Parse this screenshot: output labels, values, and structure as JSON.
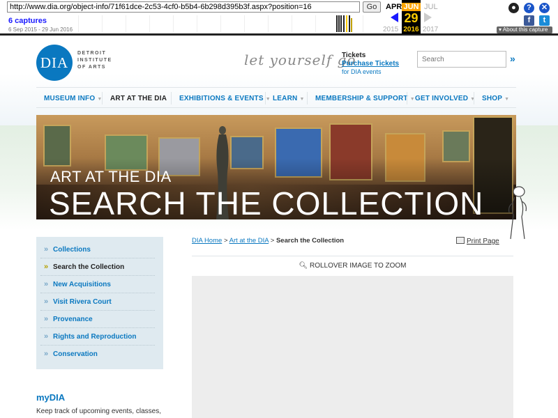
{
  "wayback": {
    "url": "http://www.dia.org/object-info/71f61dce-2c53-4cf0-b5b4-6b298d395b3f.aspx?position=16",
    "go_label": "Go",
    "captures": "6 captures",
    "range": "6 Sep 2015 - 29 Jun 2016",
    "month_prev": "APR",
    "month_cur": "JUN",
    "month_next": "JUL",
    "day": "29",
    "year_prev": "2015",
    "year_cur": "2016",
    "year_next": "2017",
    "about": "▾ About this capture"
  },
  "header": {
    "logo_letters": "DIA",
    "logo_lines": [
      "DETROIT",
      "INSTITUTE",
      "OF ARTS"
    ],
    "tagline": "let yourself go",
    "tickets_title": "Tickets",
    "tickets_link": "Purchase Tickets",
    "tickets_sub": "for DIA events",
    "search_placeholder": "Search",
    "search_go": "»"
  },
  "nav": [
    {
      "label": "MUSEUM INFO",
      "active": false
    },
    {
      "label": "ART AT THE DIA",
      "active": true
    },
    {
      "label": "EXHIBITIONS & EVENTS",
      "active": false
    },
    {
      "label": "LEARN",
      "active": false
    },
    {
      "label": "MEMBERSHIP & SUPPORT",
      "active": false
    },
    {
      "label": "GET INVOLVED",
      "active": false
    },
    {
      "label": "SHOP",
      "active": false
    }
  ],
  "banner": {
    "subtitle": "ART AT THE DIA",
    "title": "SEARCH THE COLLECTION"
  },
  "sidebar": {
    "items": [
      {
        "label": "Collections"
      },
      {
        "label": "Search the Collection"
      },
      {
        "label": "New Acquisitions"
      },
      {
        "label": "Visit Rivera Court"
      },
      {
        "label": "Provenance"
      },
      {
        "label": "Rights and Reproduction"
      },
      {
        "label": "Conservation"
      }
    ],
    "mydia_title": "myDIA",
    "mydia_text": "Keep track of upcoming events, classes,"
  },
  "main": {
    "breadcrumb": [
      "DIA Home",
      "Art at the DIA",
      "Search the Collection"
    ],
    "breadcrumb_sep": ">",
    "print_label": "Print Page",
    "zoom_label": "ROLLOVER IMAGE TO ZOOM"
  },
  "colors": {
    "brand_blue": "#0a78c0",
    "wayback_blue": "#1a1aff",
    "sidebar_bg": "#dfeaf0"
  }
}
